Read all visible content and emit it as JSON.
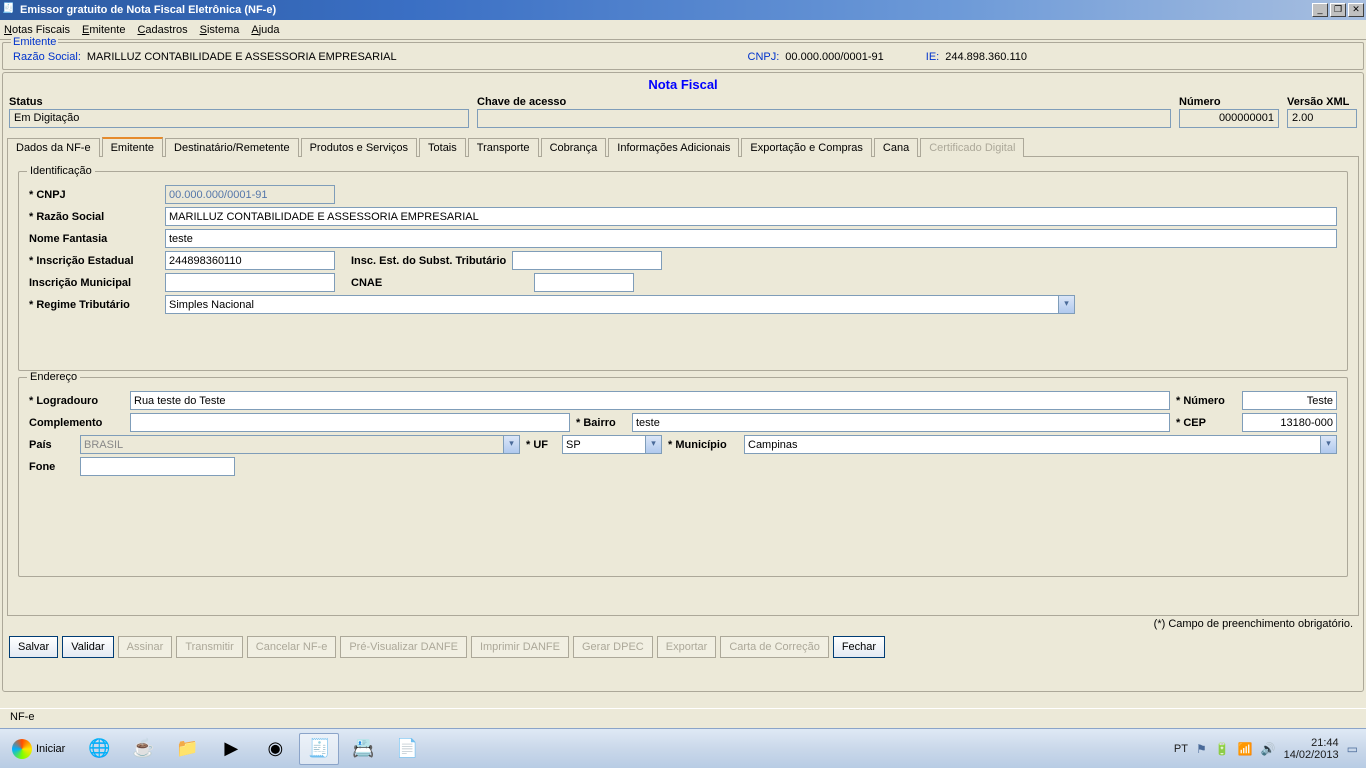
{
  "window": {
    "title": "Emissor gratuito de Nota Fiscal Eletrônica (NF-e)"
  },
  "menu": {
    "notas_fiscais": "Notas Fiscais",
    "emitente": "Emitente",
    "cadastros": "Cadastros",
    "sistema": "Sistema",
    "ajuda": "Ajuda"
  },
  "emitente_panel": {
    "legend": "Emitente",
    "razao_label": "Razão Social:",
    "razao_value": "MARILLUZ CONTABILIDADE E ASSESSORIA EMPRESARIAL",
    "cnpj_label": "CNPJ:",
    "cnpj_value": "00.000.000/0001-91",
    "ie_label": "IE:",
    "ie_value": "244.898.360.110"
  },
  "main": {
    "title": "Nota Fiscal",
    "status_label": "Status",
    "status_value": "Em Digitação",
    "chave_label": "Chave de acesso",
    "chave_value": "",
    "numero_label": "Número",
    "numero_value": "000000001",
    "versao_label": "Versão XML",
    "versao_value": "2.00"
  },
  "tabs": {
    "dados": "Dados da NF-e",
    "emitente": "Emitente",
    "destinatario": "Destinatário/Remetente",
    "produtos": "Produtos e Serviços",
    "totais": "Totais",
    "transporte": "Transporte",
    "cobranca": "Cobrança",
    "info": "Informações Adicionais",
    "export": "Exportação e Compras",
    "cana": "Cana",
    "cert": "Certificado Digital"
  },
  "ident": {
    "legend": "Identificação",
    "cnpj_label": "* CNPJ",
    "cnpj_value": "00.000.000/0001-91",
    "razao_label": "* Razão Social",
    "razao_value": "MARILLUZ CONTABILIDADE E ASSESSORIA EMPRESARIAL",
    "fantasia_label": "Nome Fantasia",
    "fantasia_value": "teste",
    "ie_label": "* Inscrição Estadual",
    "ie_value": "244898360110",
    "iest_label": "Insc. Est. do Subst. Tributário",
    "iest_value": "",
    "im_label": "Inscrição Municipal",
    "im_value": "",
    "cnae_label": "CNAE",
    "cnae_value": "",
    "regime_label": "* Regime Tributário",
    "regime_value": "Simples Nacional"
  },
  "endereco": {
    "legend": "Endereço",
    "logradouro_label": "* Logradouro",
    "logradouro_value": "Rua teste do Teste",
    "numero_label": "* Número",
    "numero_value": "Teste",
    "complemento_label": "Complemento",
    "complemento_value": "",
    "bairro_label": "* Bairro",
    "bairro_value": "teste",
    "cep_label": "* CEP",
    "cep_value": "13180-000",
    "pais_label": "País",
    "pais_value": "BRASIL",
    "uf_label": "* UF",
    "uf_value": "SP",
    "municipio_label": "* Município",
    "municipio_value": "Campinas",
    "fone_label": "Fone",
    "fone_value": ""
  },
  "footer_note": "(*) Campo de preenchimento obrigatório.",
  "buttons": {
    "salvar": "Salvar",
    "validar": "Validar",
    "assinar": "Assinar",
    "transmitir": "Transmitir",
    "cancelar": "Cancelar NF-e",
    "previs": "Pré-Visualizar DANFE",
    "imprimir": "Imprimir DANFE",
    "dpec": "Gerar DPEC",
    "exportar": "Exportar",
    "carta": "Carta de Correção",
    "fechar": "Fechar"
  },
  "statusbar": "NF-e",
  "taskbar": {
    "start": "Iniciar",
    "lang": "PT",
    "time": "21:44",
    "date": "14/02/2013"
  }
}
